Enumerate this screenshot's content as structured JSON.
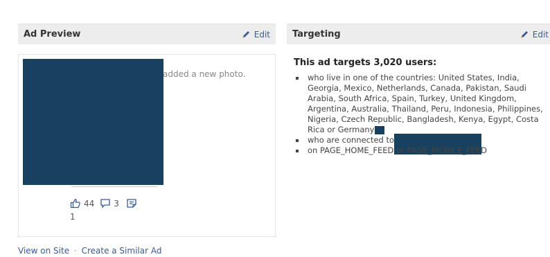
{
  "ad_preview": {
    "title": "Ad Preview",
    "edit_label": "Edit",
    "activity_text": "added a new photo.",
    "likes": "44",
    "comments": "3",
    "shares": "1"
  },
  "targeting": {
    "title": "Targeting",
    "edit_label": "Edit",
    "summary": "This ad targets 3,020 users:",
    "items": [
      "who live in one of the countries: United States, India, Georgia, Mexico, Netherlands, Canada, Pakistan, Saudi Arabia, South Africa, Spain, Turkey, United Kingdom, Argentina, Australia, Thailand, Peru, Indonesia, Philippines, Nigeria, Czech Republic, Bangladesh, Kenya, Egypt, Costa Rica or Germany",
      "who are connected to",
      "on PAGE_HOME_FEED or PAGE_MOBILE_FEED"
    ]
  },
  "footer": {
    "view_on_site": "View on Site",
    "separator": "·",
    "create_similar": "Create a Similar Ad"
  },
  "colors": {
    "redaction": "#18415f",
    "link": "#3b5998",
    "header_bg": "#ededed"
  }
}
